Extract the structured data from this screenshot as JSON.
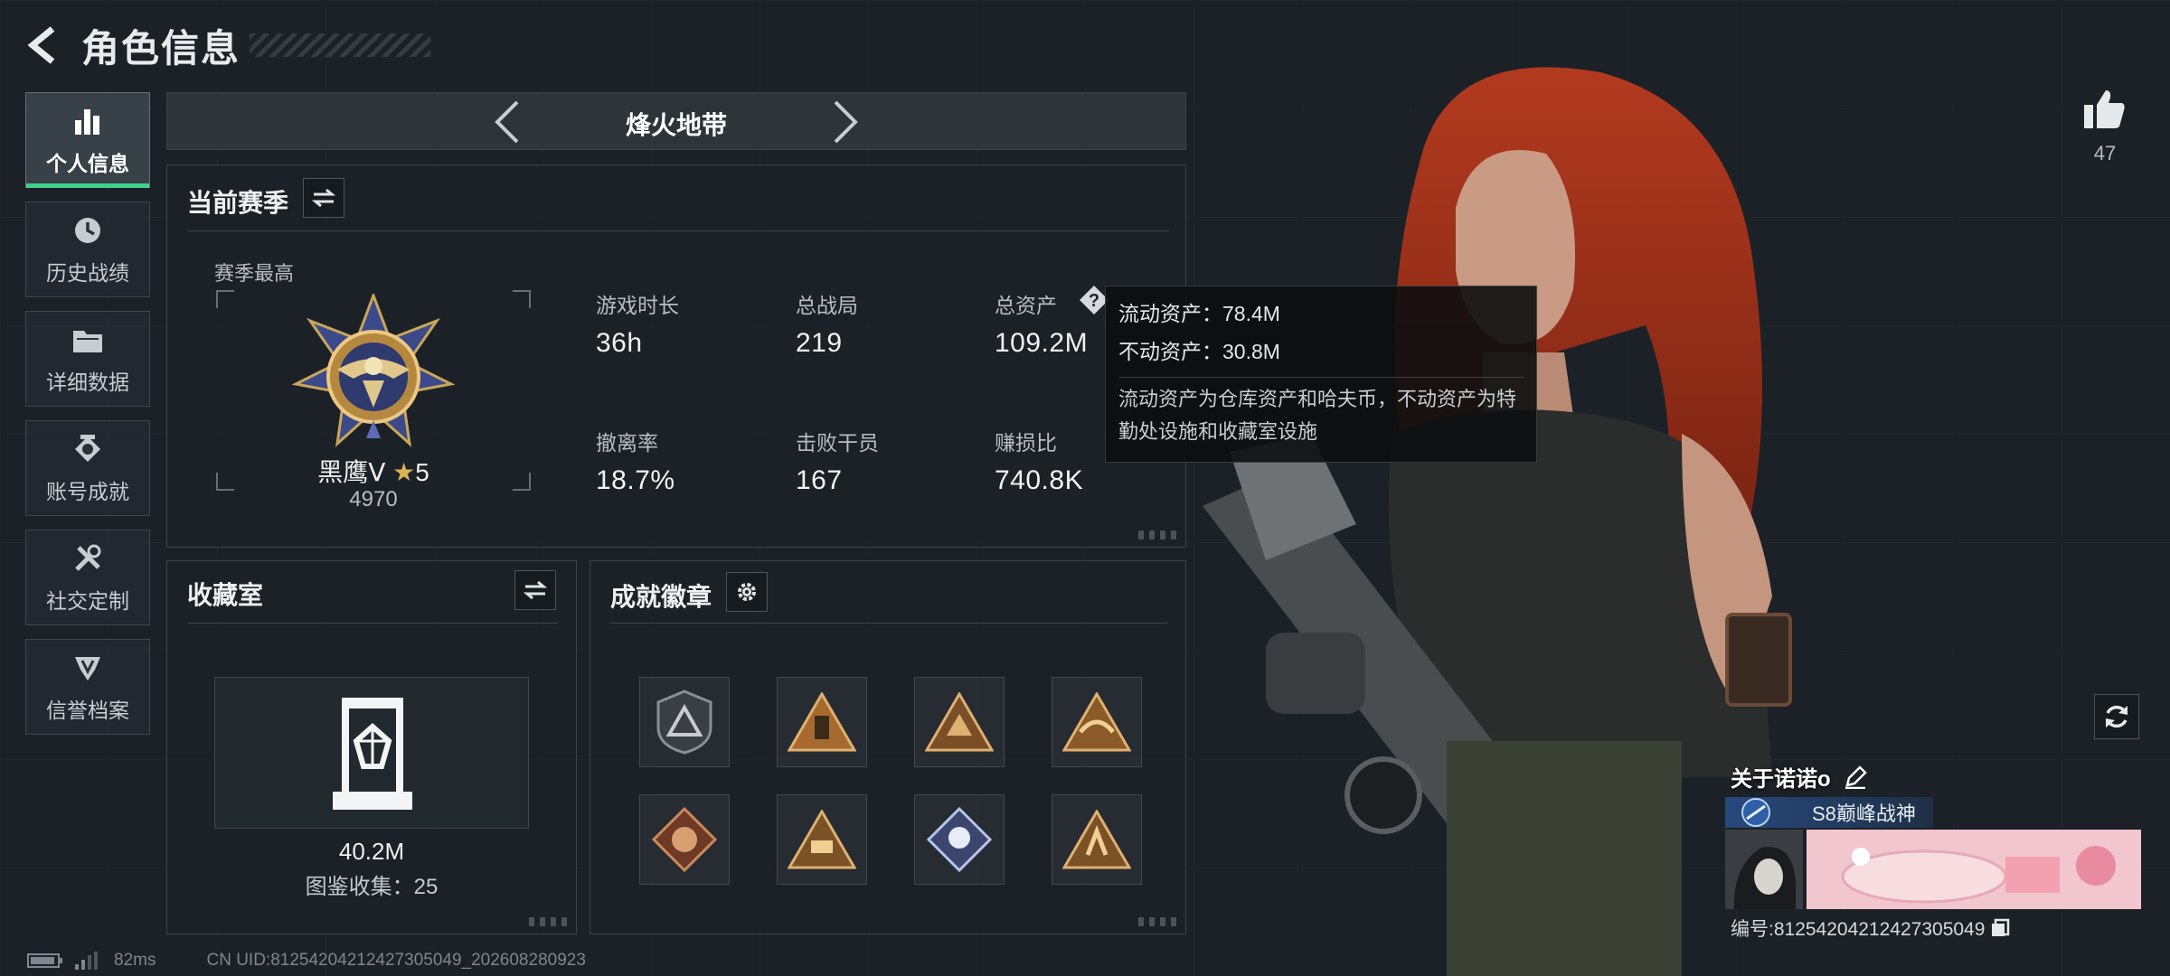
{
  "header": {
    "title": "角色信息"
  },
  "nav": [
    {
      "label": "个人信息",
      "icon": "bar-chart-icon",
      "active": true
    },
    {
      "label": "历史战绩",
      "icon": "history-icon"
    },
    {
      "label": "详细数据",
      "icon": "folder-icon"
    },
    {
      "label": "账号成就",
      "icon": "achievement-icon"
    },
    {
      "label": "社交定制",
      "icon": "tools-icon"
    },
    {
      "label": "信誉档案",
      "icon": "reputation-icon"
    }
  ],
  "mode": {
    "title": "烽火地带"
  },
  "season": {
    "title": "当前赛季",
    "best_label": "赛季最高",
    "rank_name": "黑鹰Ⅴ",
    "rank_stars": "5",
    "rank_score": "4970",
    "stats": [
      {
        "label": "游戏时长",
        "value": "36h"
      },
      {
        "label": "总战局",
        "value": "219"
      },
      {
        "label": "总资产",
        "value": "109.2M"
      },
      {
        "label": "撤离率",
        "value": "18.7%"
      },
      {
        "label": "击败干员",
        "value": "167"
      },
      {
        "label": "赚损比",
        "value": "740.8K"
      }
    ]
  },
  "tooltip": {
    "liquid": "流动资产：78.4M",
    "fixed": "不动资产：30.8M",
    "desc": "流动资产为仓库资产和哈夫币，不动资产为特勤处设施和收藏室设施"
  },
  "collection": {
    "title": "收藏室",
    "value": "40.2M",
    "count": "图鉴收集：25"
  },
  "badges": {
    "title": "成就徽章"
  },
  "profile": {
    "likes": "47",
    "about": "关于诺诺o",
    "title_tag": "S8巅峰战神",
    "uid_line": "编号:81254204212427305049"
  },
  "status": {
    "ping": "82ms",
    "uid": "CN UID:81254204212427305049_202608280923"
  },
  "colors": {
    "accent": "#3fd08c",
    "gold": "#c99a4a",
    "tooltip_bg": "#0c0e10"
  }
}
